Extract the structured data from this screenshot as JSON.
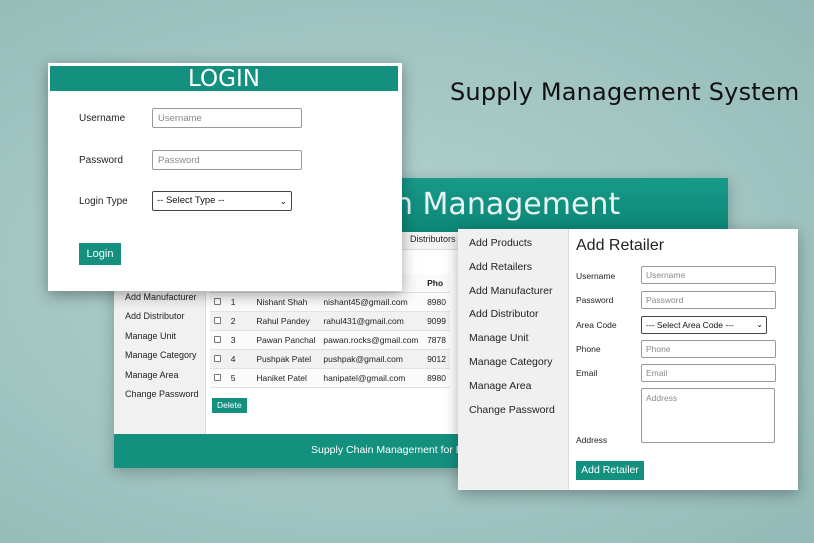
{
  "title": "Supply Management System",
  "admin": {
    "header_partial": "n Management",
    "nav_partial": "Distributors",
    "sidebar": [
      "Add Manufacturer",
      "Add Distributor",
      "Manage Unit",
      "Manage Category",
      "Manage Area",
      "Change Password"
    ],
    "table_header_partial": "Pho",
    "rows": [
      {
        "id": "1",
        "name": "Nishant Shah",
        "email": "nishant45@gmail.com",
        "phone_partial": "8980"
      },
      {
        "id": "2",
        "name": "Rahul Pandey",
        "email": "rahul431@gmail.com",
        "phone_partial": "9099"
      },
      {
        "id": "3",
        "name": "Pawan Panchal",
        "email": "pawan.rocks@gmail.com",
        "phone_partial": "7878"
      },
      {
        "id": "4",
        "name": "Pushpak Patel",
        "email": "pushpak@gmail.com",
        "phone_partial": "9012"
      },
      {
        "id": "5",
        "name": "Haniket Patel",
        "email": "hanipatel@gmail.com",
        "phone_partial": "8980"
      }
    ],
    "delete_label": "Delete",
    "footer_partial": "Supply Chain Management for B"
  },
  "login": {
    "title": "LOGIN",
    "username_label": "Username",
    "username_placeholder": "Username",
    "password_label": "Password",
    "password_placeholder": "Password",
    "type_label": "Login Type",
    "type_selected": "-- Select Type --",
    "button": "Login"
  },
  "retailer": {
    "sidebar": [
      "Add Products",
      "Add Retailers",
      "Add Manufacturer",
      "Add Distributor",
      "Manage Unit",
      "Manage Category",
      "Manage Area",
      "Change Password"
    ],
    "title": "Add Retailer",
    "username_label": "Username",
    "username_placeholder": "Username",
    "password_label": "Password",
    "password_placeholder": "Password",
    "area_label": "Area Code",
    "area_selected": "--- Select Area Code ---",
    "phone_label": "Phone",
    "phone_placeholder": "Phone",
    "email_label": "Email",
    "email_placeholder": "Email",
    "address_label": "Address",
    "address_placeholder": "Address",
    "button": "Add Retailer"
  },
  "colors": {
    "accent": "#14907f",
    "background": "#a3c6c3"
  },
  "icons": {
    "select_arrow": "chevron-down-icon"
  }
}
